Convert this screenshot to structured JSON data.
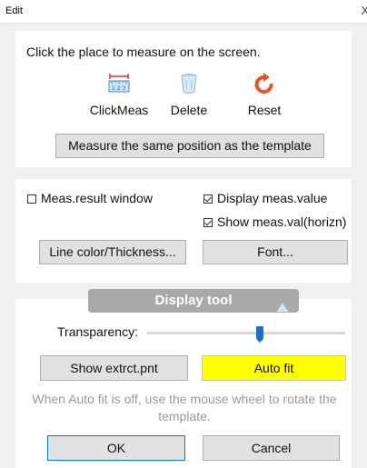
{
  "window": {
    "title": "Edit",
    "close_glyph": "X"
  },
  "measure": {
    "instruction": "Click the place to measure on the screen.",
    "tools": [
      {
        "label": "ClickMeas",
        "icon": "ruler-icon"
      },
      {
        "label": "Delete",
        "icon": "trash-can-icon"
      },
      {
        "label": "Reset",
        "icon": "reset-arrow-icon"
      }
    ],
    "template_button": "Measure the same position as the template"
  },
  "options": {
    "result_window": {
      "label": "Meas.result window",
      "checked": false
    },
    "display_value": {
      "label": "Display meas.value",
      "checked": true
    },
    "show_horizn": {
      "label": "Show meas.val(horizn)",
      "checked": true
    },
    "line_button": "Line color/Thickness...",
    "font_button": "Font..."
  },
  "display_tool": {
    "header": "Display tool",
    "header_icon": "triangle-up-icon",
    "transparency_label": "Transparency:",
    "transparency_value": 0.57,
    "extract_button": "Show extrct.pnt",
    "autofit_button": "Auto fit",
    "note": "When Auto fit is off, use the mouse wheel to rotate the template."
  },
  "footer": {
    "ok": "OK",
    "cancel": "Cancel"
  },
  "colors": {
    "background": "#f0f0f0",
    "panel": "#ffffff",
    "header_bar": "#a9a9a9",
    "autofit_highlight": "#ffff00",
    "slider_thumb": "#1a70d1",
    "reset_icon": "#e8532b",
    "ruler_icon": "#3b8ee0",
    "note_text": "#9a9a9a"
  }
}
